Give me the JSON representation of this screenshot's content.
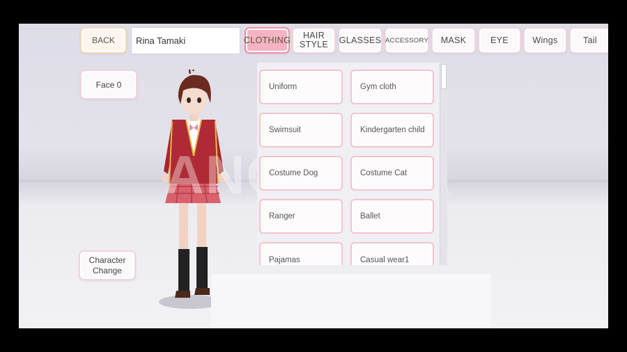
{
  "header": {
    "back_label": "BACK",
    "name_value": "Rina Tamaki",
    "tabs": [
      {
        "label": "CLOTHING",
        "active": true
      },
      {
        "label": "HAIR\nSTYLE",
        "active": false
      },
      {
        "label": "GLASSES",
        "active": false
      },
      {
        "label": "ACCESSORY",
        "active": false
      },
      {
        "label": "MASK",
        "active": false
      },
      {
        "label": "EYE",
        "active": false
      },
      {
        "label": "Wings",
        "active": false
      },
      {
        "label": "Tail",
        "active": false
      }
    ]
  },
  "left": {
    "face_label": "Face 0",
    "character_change_label": "Character\nChange"
  },
  "clothing_items": [
    "Uniform",
    "Gym cloth",
    "Swimsuit",
    "Kindergarten child",
    "Costume Dog",
    "Costume Cat",
    "Ranger",
    "Ballet",
    "Pajamas",
    "Casual wear1"
  ],
  "watermark": "ANOOSHA",
  "colors": {
    "active_tab": "#f5b3c3",
    "button_border": "#f1d3dc",
    "item_border": "#f3c3cd"
  }
}
